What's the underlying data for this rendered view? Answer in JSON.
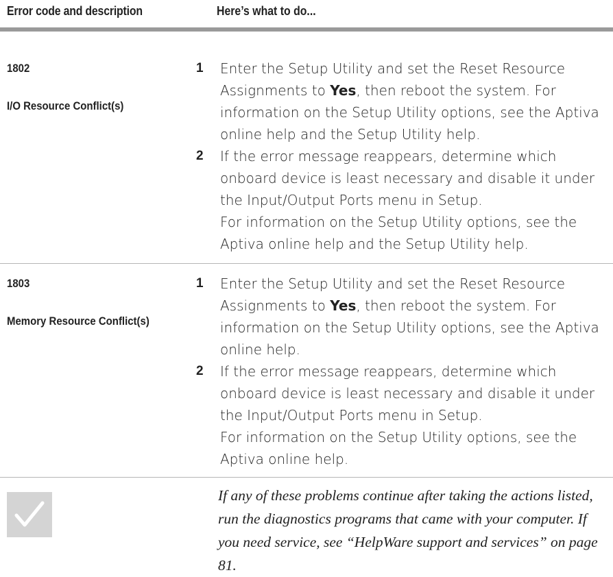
{
  "table": {
    "header": {
      "col1": "Error code and description",
      "col2": "Here’s what to do..."
    },
    "rows": [
      {
        "code": "1802",
        "description": "I/O Resource Conflict(s)",
        "steps": [
          {
            "number": "1",
            "text_before": "Enter the Setup Utility and set the Reset Resource Assignments to ",
            "emphasis": "Yes",
            "text_after": ", then reboot the system. For information on the Setup Utility options, see the Aptiva online help and the Setup Utility help."
          },
          {
            "number": "2",
            "text": "If the error message reappears, determine which onboard device is least necessary and disable it under the Input/Output Ports menu in Setup.",
            "text_more": "For information on the Setup Utility options, see the Aptiva online help and the Setup Utility help."
          }
        ]
      },
      {
        "code": "1803",
        "description": "Memory Resource Conflict(s)",
        "steps": [
          {
            "number": "1",
            "text_before": "Enter the Setup Utility and set the Reset Resource Assignments to ",
            "emphasis": "Yes",
            "text_after": ", then reboot the system. For information on the Setup Utility options, see the Aptiva online help."
          },
          {
            "number": "2",
            "text": "If the error message reappears, determine which onboard device is least necessary and disable it under the Input/Output Ports menu in Setup.",
            "text_more": "For information on the Setup Utility options, see the Aptiva online help."
          }
        ]
      }
    ]
  },
  "note": {
    "icon": "checkmark-icon",
    "text": "If any of these problems continue after taking the actions listed, run the diagnostics programs that came with your computer. If you need service, see “HelpWare support and services” on page 81."
  },
  "colors": {
    "header_rule": "#9a9a9a",
    "row_rule": "#b5b5b5",
    "check_box": "#d4d4d4"
  }
}
